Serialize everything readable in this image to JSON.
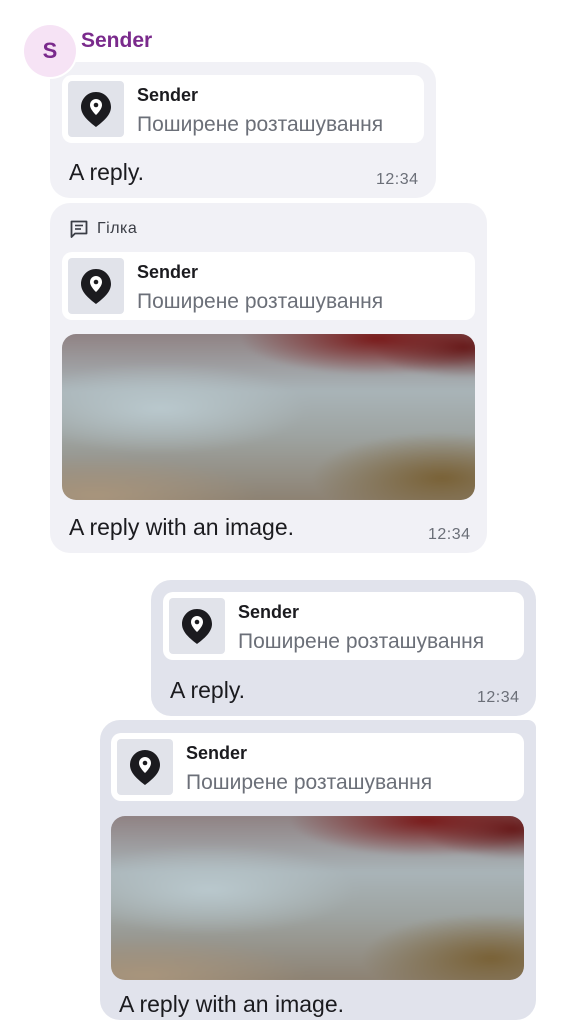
{
  "sender": {
    "initial": "S",
    "name": "Sender"
  },
  "messages": [
    {
      "reply": {
        "sender": "Sender",
        "text": "Поширене розташування"
      },
      "text": "A reply.",
      "time": "12:34"
    },
    {
      "thread_label": "Гілка",
      "reply": {
        "sender": "Sender",
        "text": "Поширене розташування"
      },
      "text": "A reply with an image.",
      "time": "12:34"
    },
    {
      "reply": {
        "sender": "Sender",
        "text": "Поширене розташування"
      },
      "text": "A reply.",
      "time": "12:34"
    },
    {
      "reply": {
        "sender": "Sender",
        "text": "Поширене розташування"
      },
      "text": "A reply with an image."
    }
  ],
  "icons": {
    "location": "location-pin-icon",
    "thread": "thread-icon"
  },
  "colors": {
    "sender_accent": "#7a2a8c",
    "avatar_bg": "#f6e3f5",
    "incoming_bubble": "#f1f1f6",
    "outgoing_bubble": "#e1e3ec"
  }
}
